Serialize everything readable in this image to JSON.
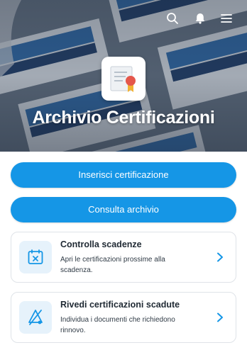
{
  "header": {
    "title": "Archivio Certificazioni",
    "icons": [
      "search-icon",
      "bell-icon",
      "menu-icon"
    ]
  },
  "actions": {
    "insert_label": "Inserisci certificazione",
    "browse_label": "Consulta archivio"
  },
  "cards": [
    {
      "title": "Controlla scadenze",
      "description": "Apri le certificazioni prossime alla scadenza.",
      "icon": "calendar-x-icon"
    },
    {
      "title": "Rivedi certificazioni scadute",
      "description": "Individua i documenti che richiedono rinnovo.",
      "icon": "expired-tag-icon"
    }
  ],
  "colors": {
    "accent": "#1596e6",
    "icon_tile": "#e6f2fb"
  }
}
